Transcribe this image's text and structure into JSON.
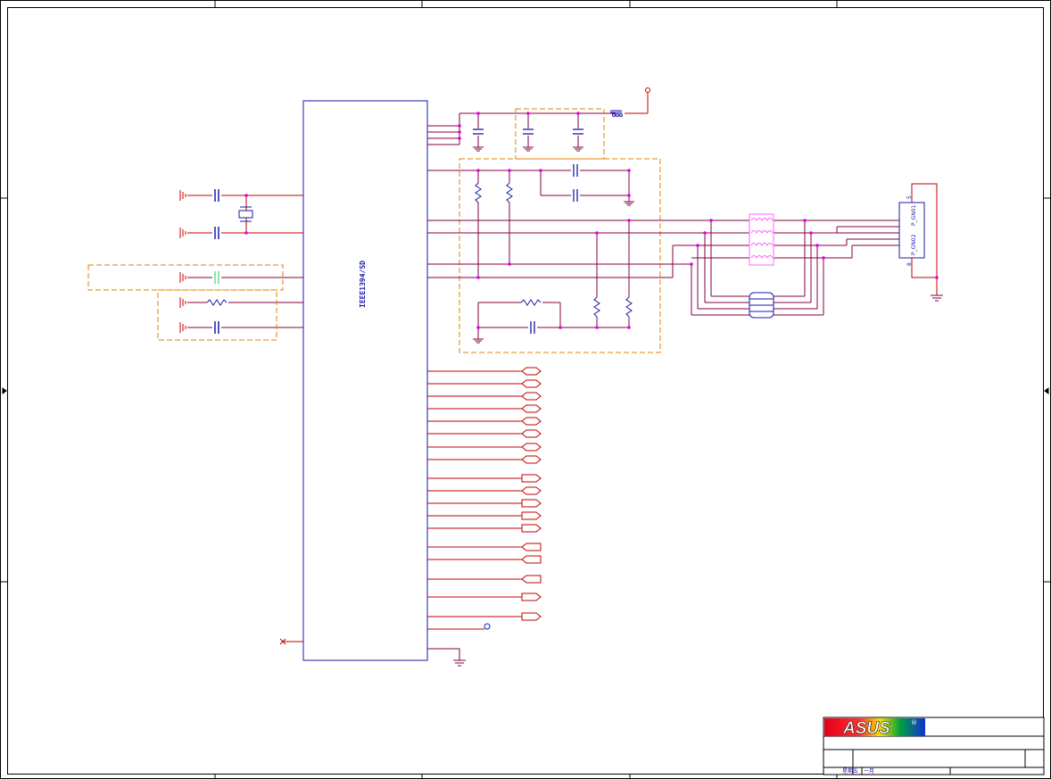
{
  "chip": {
    "label": "IEEE1394/SD"
  },
  "connector": {
    "pin_top": "5",
    "pin_bottom": "8",
    "label_a": "P_GN01",
    "label_b": "P_GN02"
  },
  "title_block": {
    "logo_text": "ASUS",
    "registered_mark": "®",
    "footer_a": "星期五",
    "footer_b": "一月"
  },
  "colors": {
    "net": "#c00000",
    "wire": "#800040",
    "component": "#1a1aa8",
    "junction": "#e000e0",
    "group_box": "#e08000",
    "filter": "#ff66ff",
    "ghost_cap": "#66dd88"
  },
  "icons": [
    "ground-icon",
    "power-port-icon",
    "crystal-icon",
    "common-mode-choke-icon",
    "ferrite-bead-icon",
    "test-point-icon",
    "no-connect-icon",
    "asus-logo-icon"
  ]
}
